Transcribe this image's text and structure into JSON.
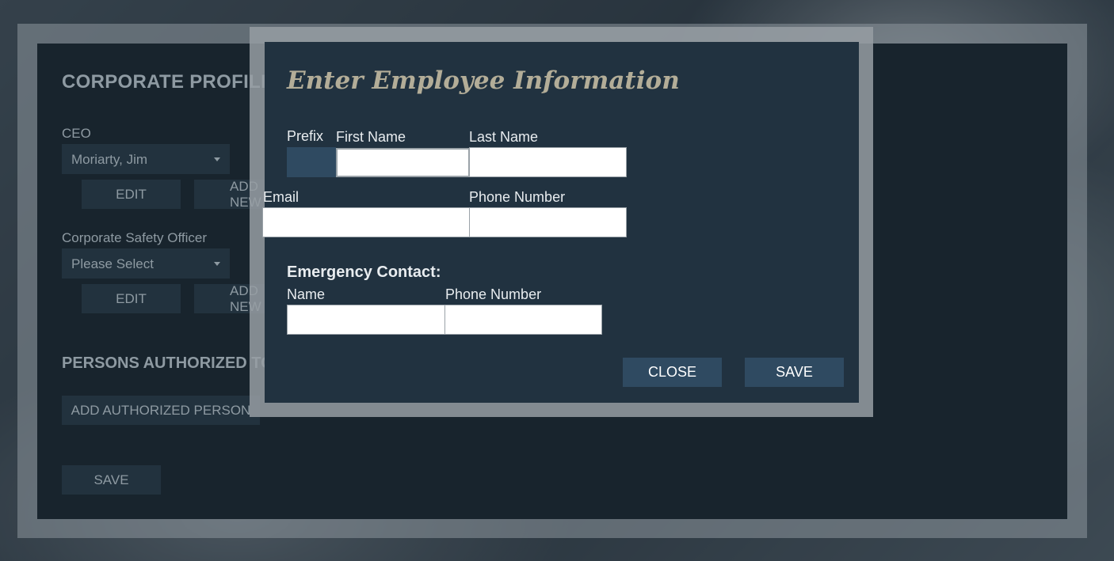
{
  "background_panel": {
    "title": "CORPORATE PROFILE",
    "ceo": {
      "label": "CEO",
      "selected": "Moriarty, Jim",
      "edit": "EDIT",
      "add": "ADD NEW"
    },
    "safety_officer": {
      "label": "Corporate Safety Officer",
      "selected": "Please Select",
      "edit": "EDIT",
      "add": "ADD NEW"
    },
    "authorized_section": {
      "heading": "PERSONS AUTHORIZED TO",
      "add_button": "ADD AUTHORIZED PERSON"
    },
    "save": "SAVE"
  },
  "modal": {
    "title": "Enter Employee Information",
    "fields": {
      "prefix_label": "Prefix",
      "first_name_label": "First Name",
      "last_name_label": "Last Name",
      "email_label": "Email",
      "phone_label": "Phone Number",
      "first_name_value": "",
      "last_name_value": "",
      "email_value": "",
      "phone_value": ""
    },
    "emergency": {
      "heading": "Emergency Contact:",
      "name_label": "Name",
      "phone_label": "Phone Number",
      "name_value": "",
      "phone_value": ""
    },
    "close": "CLOSE",
    "save": "SAVE"
  },
  "colors": {
    "panel_bg": "#18242d",
    "modal_bg": "#213240",
    "modal_button": "#2f4a61",
    "title_accent": "#b3ad98"
  }
}
